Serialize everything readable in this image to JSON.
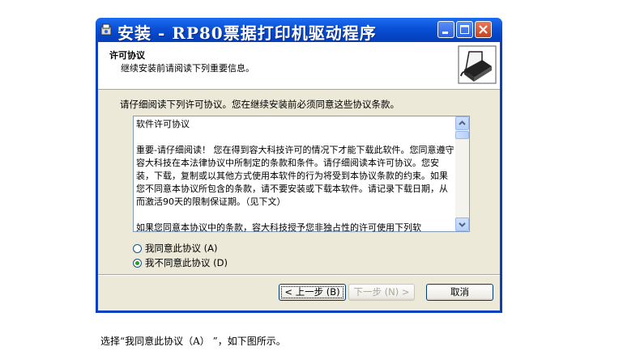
{
  "window": {
    "title": "安装 - RP80票据打印机驱动程序",
    "minimize_icon": "minimize-icon",
    "maximize_icon": "maximize-icon",
    "close_icon": "close-icon"
  },
  "header": {
    "title": "许可协议",
    "subtitle": "继续安装前请阅读下列重要信息。",
    "icon": "printer-icon"
  },
  "instruction": "请仔细阅读下列许可协议。您在继续安装前必须同意这些协议条款。",
  "license": {
    "lines": [
      "软件许可协议",
      "",
      "重要-请仔细阅读！ 您在得到容大科技许可的情况下才能下载此软件。您同意遵守容大科技在本法律协议中所制定的条款和条件。请仔细阅读本许可协议。您安装，下载，复制或以其他方式使用本软件的行为将受到本协议条款的约束。如果您不同意本协议所包含的条款，请不要安装或下载本软件。请记录下载日期，从而激活90天的限制保证期。（见下文）",
      "",
      "如果您同意本协议中的条款，容大科技授予您非独占性的许可使用下列软"
    ]
  },
  "radios": {
    "accept_label": "我同意此协议 (A)",
    "decline_label": "我不同意此协议 (D)",
    "selected": "decline"
  },
  "buttons": {
    "back": "< 上一步 (B)",
    "next": "下一步 (N) >",
    "cancel": "取消"
  },
  "caption": "选择“我同意此协议（A） ”，如下图所示。",
  "colors": {
    "titlebar": "#0a4fd6",
    "dialog_bg": "#ece9d8",
    "close_button": "#c8411e",
    "radio_dot": "#21a121"
  }
}
